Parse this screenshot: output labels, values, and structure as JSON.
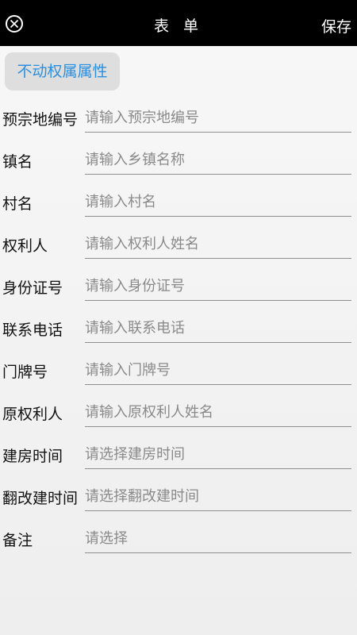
{
  "header": {
    "title": "表 单",
    "save_label": "保存"
  },
  "section_tab": "不动权属属性",
  "form": [
    {
      "label": "预宗地编号",
      "placeholder": "请输入预宗地编号"
    },
    {
      "label": "镇名",
      "placeholder": "请输入乡镇名称"
    },
    {
      "label": "村名",
      "placeholder": "请输入村名"
    },
    {
      "label": "权利人",
      "placeholder": "请输入权利人姓名"
    },
    {
      "label": "身份证号",
      "placeholder": "请输入身份证号"
    },
    {
      "label": "联系电话",
      "placeholder": "请输入联系电话"
    },
    {
      "label": "门牌号",
      "placeholder": "请输入门牌号"
    },
    {
      "label": "原权利人",
      "placeholder": "请输入原权利人姓名"
    },
    {
      "label": "建房时间",
      "placeholder": "请选择建房时间"
    },
    {
      "label": "翻改建时间",
      "placeholder": "请选择翻改建时间"
    },
    {
      "label": "备注",
      "placeholder": "请选择"
    }
  ]
}
